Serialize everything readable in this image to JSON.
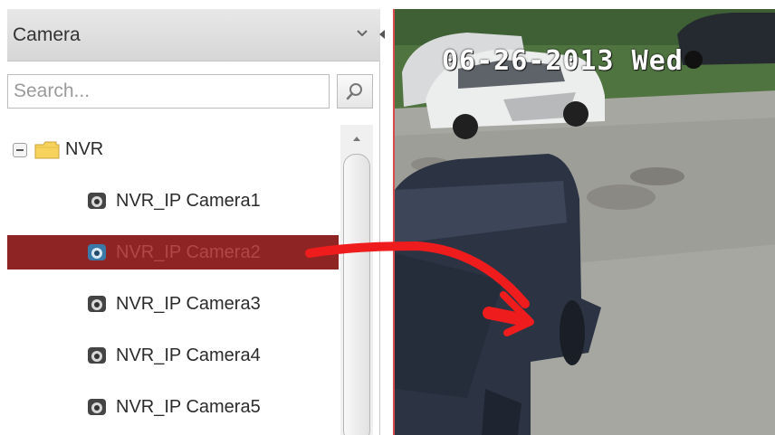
{
  "panel": {
    "title": "Camera",
    "search": {
      "placeholder": "Search...",
      "value": ""
    }
  },
  "tree": {
    "root": {
      "label": "NVR"
    },
    "items": [
      {
        "label": "NVR_IP Camera1",
        "selected": false
      },
      {
        "label": "NVR_IP Camera2",
        "selected": true
      },
      {
        "label": "NVR_IP Camera3",
        "selected": false
      },
      {
        "label": "NVR_IP Camera4",
        "selected": false
      },
      {
        "label": "NVR_IP Camera5",
        "selected": false
      }
    ]
  },
  "video": {
    "osd_text": "06-26-2013 Wed"
  },
  "colors": {
    "selected_row": "#8e2424",
    "drag_arrow": "#ee1c1c",
    "video_border": "#d94a4a"
  },
  "icons": [
    "chevron-down-icon",
    "search-icon",
    "folder-icon",
    "camera-icon",
    "scroll-up-icon"
  ]
}
